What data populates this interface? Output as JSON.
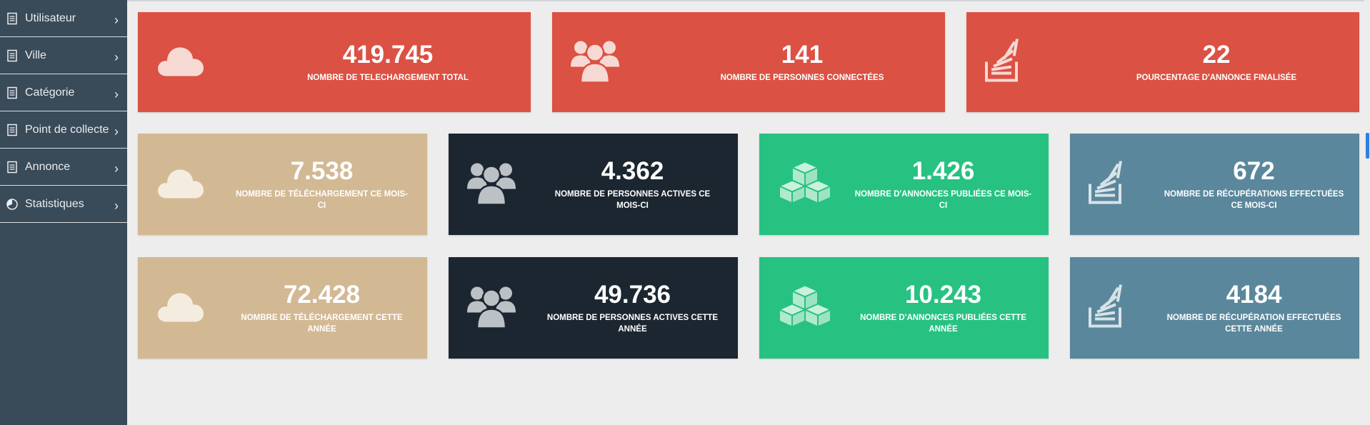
{
  "sidebar": {
    "items": [
      {
        "label": "Utilisateur",
        "icon": "document-icon"
      },
      {
        "label": "Ville",
        "icon": "document-icon"
      },
      {
        "label": "Catégorie",
        "icon": "document-icon"
      },
      {
        "label": "Point de collecte",
        "icon": "document-icon"
      },
      {
        "label": "Annonce",
        "icon": "document-icon"
      },
      {
        "label": "Statistiques",
        "icon": "pie-chart-icon"
      }
    ],
    "chevron": "›"
  },
  "stats": {
    "row1": [
      {
        "value": "419.745",
        "label": "NOMBRE DE TELECHARGEMENT TOTAL",
        "icon": "cloud-icon",
        "color": "#db5143"
      },
      {
        "value": "141",
        "label": "NOMBRE DE PERSONNES CONNECTÉES",
        "icon": "users-icon",
        "color": "#db5143"
      },
      {
        "value": "22",
        "label": "POURCENTAGE D'ANNONCE FINALISÉE",
        "icon": "stack-icon",
        "color": "#db5143"
      }
    ],
    "row2": [
      {
        "value": "7.538",
        "label_line1": "NOMBRE DE TÉLÉCHARGEMENT CE MOIS-",
        "label_line2": "CI",
        "icon": "cloud-icon",
        "color": "#d2b994"
      },
      {
        "value": "4.362",
        "label_line1": "NOMBRE DE PERSONNES ACTIVES CE",
        "label_line2": "MOIS-CI",
        "icon": "users-icon",
        "color": "#1c2631"
      },
      {
        "value": "1.426",
        "label_line1": "NOMBRE D'ANNONCES PUBLIÉES CE MOIS-",
        "label_line2": "CI",
        "icon": "cubes-icon",
        "color": "#27c282"
      },
      {
        "value": "672",
        "label_line1": "NOMBRE DE RÉCUPÉRATIONS EFFECTUÉES",
        "label_line2": "CE MOIS-CI",
        "icon": "stack-icon",
        "color": "#5a879c"
      }
    ],
    "row3": [
      {
        "value": "72.428",
        "label_line1": "NOMBRE DE TÉLÉCHARGEMENT CETTE",
        "label_line2": "ANNÉE",
        "icon": "cloud-icon",
        "color": "#d2b994"
      },
      {
        "value": "49.736",
        "label_line1": "NOMBRE DE PERSONNES ACTIVES CETTE",
        "label_line2": "ANNÉE",
        "icon": "users-icon",
        "color": "#1c2631"
      },
      {
        "value": "10.243",
        "label_line1": "NOMBRE D'ANNONCES PUBLIÉES CETTE",
        "label_line2": "ANNÉE",
        "icon": "cubes-icon",
        "color": "#27c282"
      },
      {
        "value": "4184",
        "label_line1": "NOMBRE DE RÉCUPÉRATION EFFECTUÉES",
        "label_line2": "CETTE ANNÉE",
        "icon": "stack-icon",
        "color": "#5a879c"
      }
    ]
  }
}
